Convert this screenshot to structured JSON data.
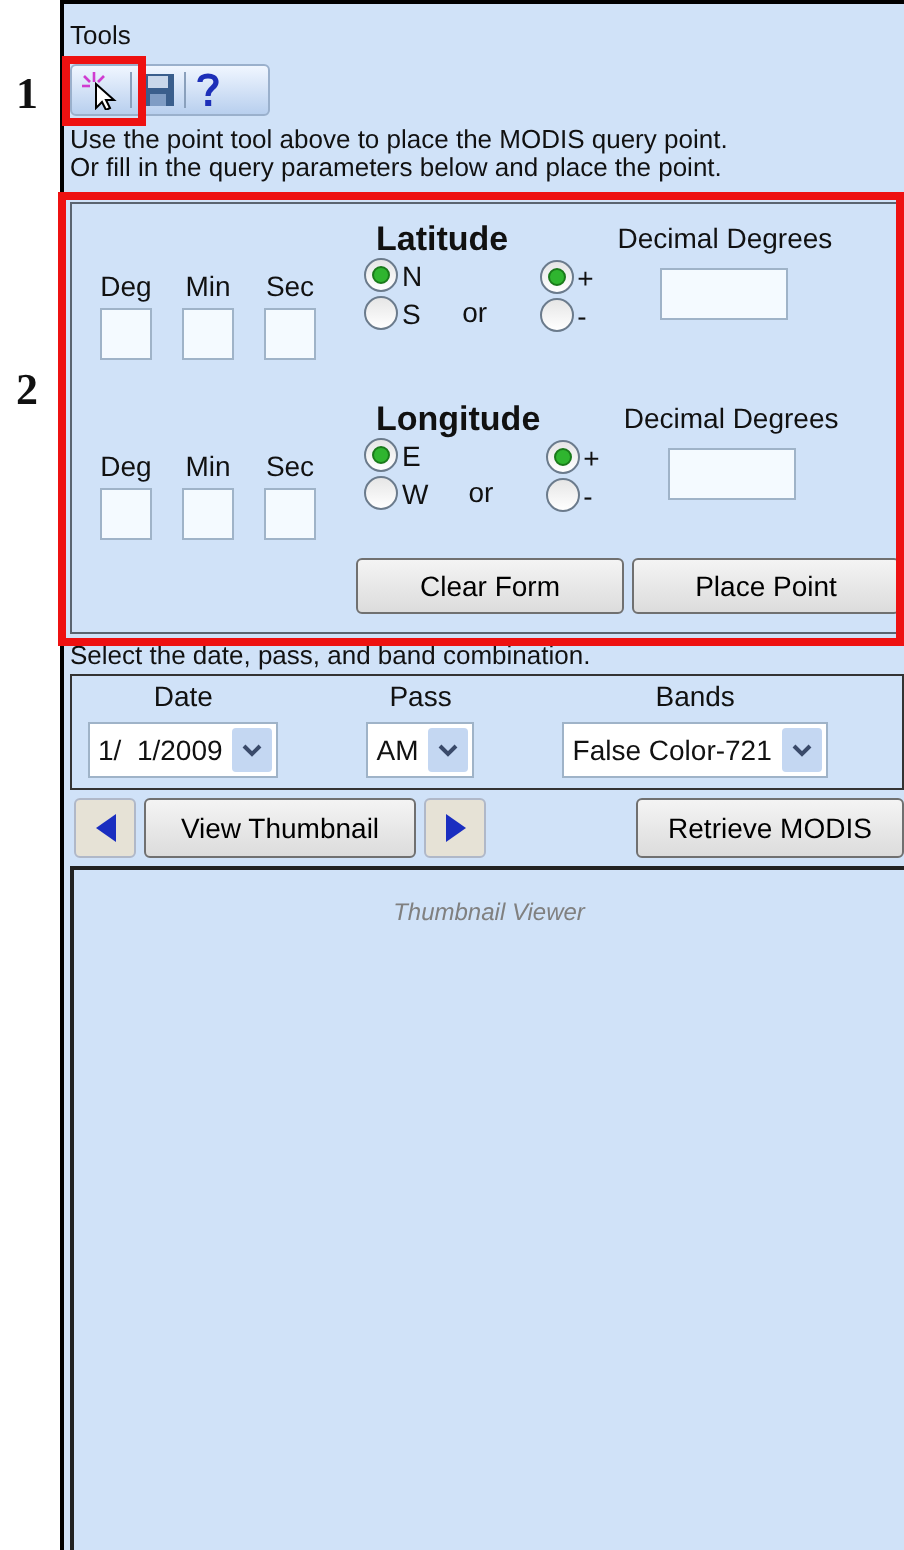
{
  "callouts": [
    "1",
    "2"
  ],
  "tools": {
    "title": "Tools"
  },
  "instructions": [
    "Use the point tool above to place the MODIS query point.",
    "Or fill in the query parameters below and place the point."
  ],
  "coordinates": [
    {
      "title": "Latitude",
      "dms_labels": [
        "Deg",
        "Min",
        "Sec"
      ],
      "hemispheres": [
        {
          "label": "N",
          "selected": true
        },
        {
          "label": "S",
          "selected": false
        }
      ],
      "or": "or",
      "signs": [
        {
          "label": "+",
          "selected": true
        },
        {
          "label": "-",
          "selected": false
        }
      ],
      "decimal_label": "Decimal Degrees"
    },
    {
      "title": "Longitude",
      "dms_labels": [
        "Deg",
        "Min",
        "Sec"
      ],
      "hemispheres": [
        {
          "label": "E",
          "selected": true
        },
        {
          "label": "W",
          "selected": false
        }
      ],
      "or": "or",
      "signs": [
        {
          "label": "+",
          "selected": true
        },
        {
          "label": "-",
          "selected": false
        }
      ],
      "decimal_label": "Decimal Degrees"
    }
  ],
  "form_buttons": [
    "Clear Form",
    "Place Point"
  ],
  "selection_hint": "Select the date, pass, and band combination.",
  "selectors": [
    {
      "label": "Date",
      "value": "1/  1/2009"
    },
    {
      "label": "Pass",
      "value": "AM"
    },
    {
      "label": "Bands",
      "value": "False Color-721"
    }
  ],
  "view_thumbnail": "View Thumbnail",
  "retrieve": "Retrieve MODIS",
  "thumbnail_viewer": "Thumbnail Viewer"
}
